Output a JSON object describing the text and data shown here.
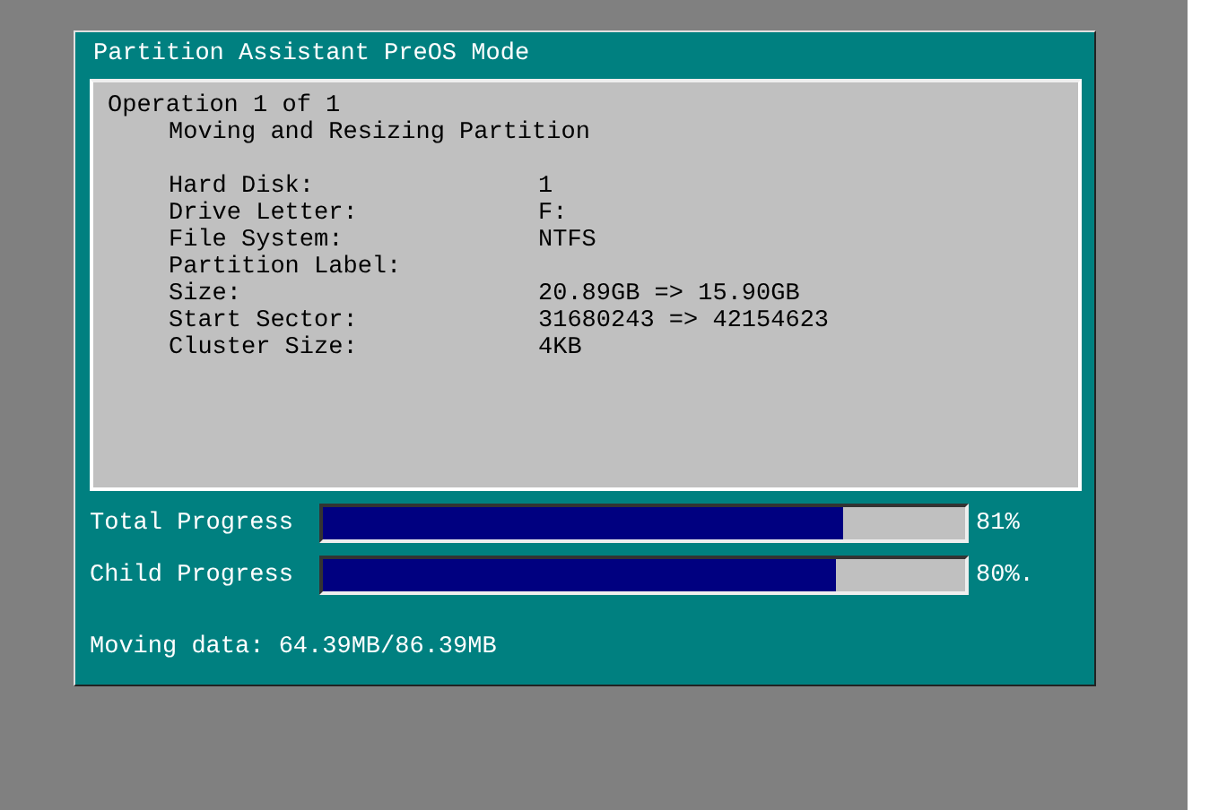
{
  "window": {
    "title": "Partition Assistant PreOS Mode"
  },
  "operation": {
    "heading": "Operation 1 of 1",
    "name": "Moving and Resizing Partition"
  },
  "details": [
    {
      "label": "Hard Disk:",
      "value": "1"
    },
    {
      "label": "Drive Letter:",
      "value": "F:"
    },
    {
      "label": "File System:",
      "value": "NTFS"
    },
    {
      "label": "Partition Label:"
    },
    {
      "label": "Size:",
      "value": "20.89GB => 15.90GB"
    },
    {
      "label": "Start Sector:",
      "value": "31680243 => 42154623"
    },
    {
      "label": "Cluster Size:",
      "value": "4KB"
    }
  ],
  "progress": [
    {
      "label": "Total Progress",
      "level": 0.81,
      "reading": "81%"
    },
    {
      "label": "Child Progress",
      "level": 0.8,
      "reading": "80%."
    }
  ],
  "status": "Moving data: 64.39MB/86.39MB"
}
